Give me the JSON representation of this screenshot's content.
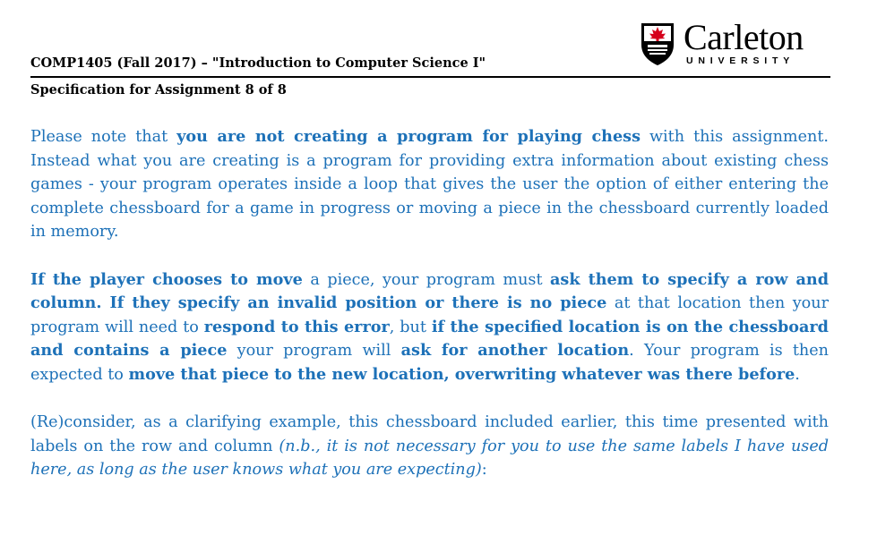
{
  "header": {
    "course": "COMP1405 (Fall 2017) – \"Introduction to Computer Science I\"",
    "spec": "Specification for Assignment 8 of 8",
    "logo_name": "Carleton",
    "logo_sub": "UNIVERSITY",
    "logo_icon": "carleton-crest-maple-leaf"
  },
  "colors": {
    "body_text": "#1d71b8",
    "header_text": "#000000",
    "crest_red": "#d6001c"
  },
  "paragraphs": [
    {
      "segments": [
        {
          "t": "Please note that ",
          "s": ""
        },
        {
          "t": "you are not creating a program for playing chess",
          "s": "b"
        },
        {
          "t": " with this assignment. Instead what you are creating is a program for providing extra information about existing chess games - your program operates inside a loop that gives the user the option of either entering the complete chessboard for a game in progress or moving a piece in the chessboard currently loaded in memory.",
          "s": ""
        }
      ]
    },
    {
      "segments": [
        {
          "t": "If the player chooses to move",
          "s": "b"
        },
        {
          "t": " a piece, your program must ",
          "s": ""
        },
        {
          "t": "ask them to specify a row and column. If they specify an invalid position or there is no piece",
          "s": "b"
        },
        {
          "t": " at that location then your program will need to ",
          "s": ""
        },
        {
          "t": "respond to this error",
          "s": "b"
        },
        {
          "t": ", but ",
          "s": ""
        },
        {
          "t": "if the specified location is on the chessboard and contains a piece",
          "s": "b"
        },
        {
          "t": " your program will ",
          "s": ""
        },
        {
          "t": "ask for another location",
          "s": "b"
        },
        {
          "t": ". Your program is then expected to ",
          "s": ""
        },
        {
          "t": "move that piece to the new location, overwriting whatever was there before",
          "s": "b"
        },
        {
          "t": ".",
          "s": ""
        }
      ]
    },
    {
      "segments": [
        {
          "t": "(Re)consider, as a clarifying example, this chessboard included earlier, this time presented with labels on the row and column ",
          "s": ""
        },
        {
          "t": "(n.b., it is not necessary for you to use the same labels I have used here, as long as the user knows what you are expecting)",
          "s": "i"
        },
        {
          "t": ":",
          "s": ""
        }
      ]
    }
  ]
}
